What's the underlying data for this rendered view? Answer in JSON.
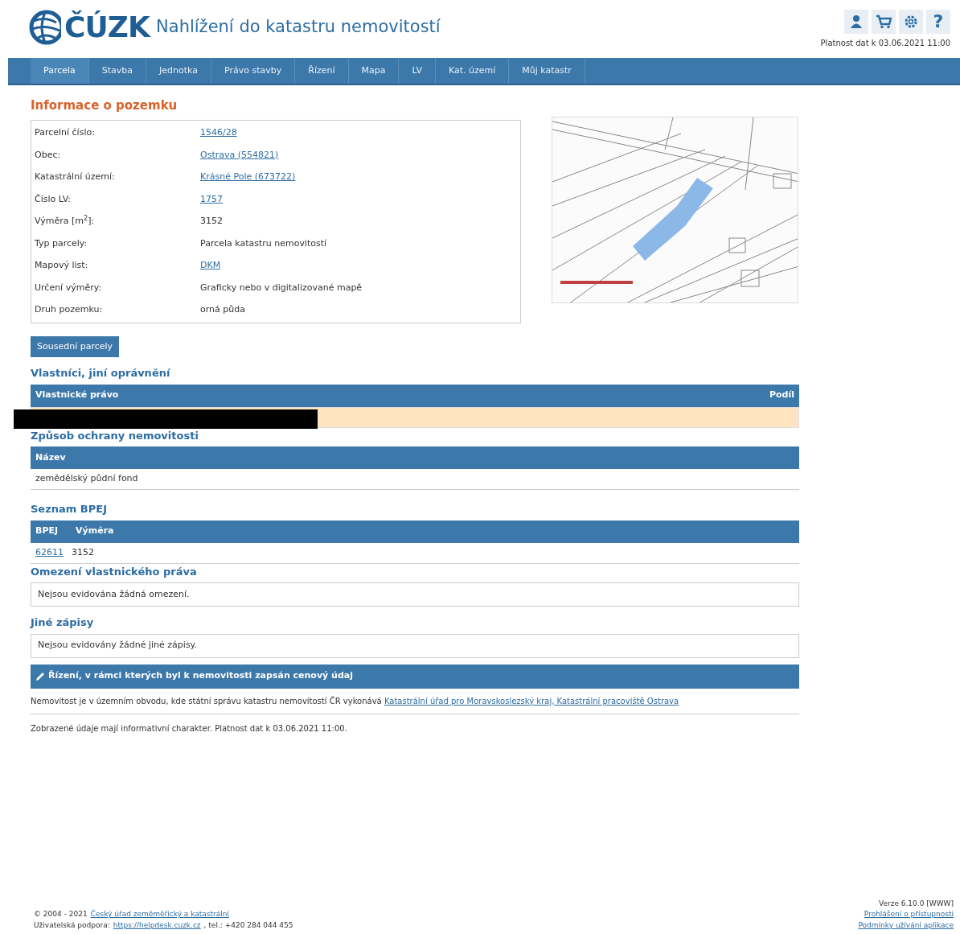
{
  "header": {
    "logo": "ČÚZK",
    "title": "Nahlížení do katastru nemovitostí",
    "validity": "Platnost dat k 03.06.2021 11:00",
    "help": "?"
  },
  "nav": [
    {
      "label": "Parcela",
      "selected": true
    },
    {
      "label": "Stavba",
      "selected": false
    },
    {
      "label": "Jednotka",
      "selected": false
    },
    {
      "label": "Právo stavby",
      "selected": false
    },
    {
      "label": "Řízení",
      "selected": false
    },
    {
      "label": "Mapa",
      "selected": false
    },
    {
      "label": "LV",
      "selected": false
    },
    {
      "label": "Kat. území",
      "selected": false
    },
    {
      "label": "Můj katastr",
      "selected": false
    }
  ],
  "info": {
    "title": "Informace o pozemku",
    "rows": [
      {
        "label": "Parcelní číslo:",
        "value": "1546/28",
        "link": true
      },
      {
        "label": "Obec:",
        "value": "Ostrava (554821)",
        "link": true
      },
      {
        "label": "Katastrální území:",
        "value": "Krásné Pole (673722)",
        "link": true
      },
      {
        "label": "Číslo LV:",
        "value": "1757",
        "link": true
      },
      {
        "label": "Výměra [m$^{2}$]:",
        "value": "3152",
        "link": false
      },
      {
        "label": "Typ parcely:",
        "value": "Parcela katastru nemovitostí",
        "link": false
      },
      {
        "label": "Mapový list:",
        "value": "DKM",
        "link": true
      },
      {
        "label": "Určení výměry:",
        "value": "Graficky nebo v digitalizované mapě",
        "link": false
      },
      {
        "label": "Druh pozemku:",
        "value": "orná půda",
        "link": false
      }
    ],
    "button": "Sousední parcely"
  },
  "owners": {
    "title": "Vlastníci, jiní oprávnění",
    "columns": [
      "Vlastnické právo",
      "Podíl"
    ],
    "redacted": true
  },
  "protection": {
    "title": "Způsob ochrany nemovitosti",
    "columns": [
      "Název"
    ],
    "rows": [
      "zemědělský půdní fond"
    ]
  },
  "bpej": {
    "title": "Seznam BPEJ",
    "columns": [
      "BPEJ",
      "Výměra"
    ],
    "rows": [
      {
        "code": "62611",
        "area": "3152"
      }
    ]
  },
  "restrictions": {
    "title": "Omezení vlastnického práva",
    "text": "Nejsou evidována žádná omezení."
  },
  "other": {
    "title": "Jiné zápisy",
    "text": "Nejsou evidovány žádné jiné zápisy."
  },
  "proceedings": {
    "title": "Řízení, v rámci kterých byl k nemovitosti zapsán cenový údaj",
    "text": "Nemovitost je v územním obvodu, kde státní správu katastru nemovitostí ČR vykonává",
    "link": "Katastrální úřad pro Moravskoslezský kraj, Katastrální pracoviště Ostrava"
  },
  "note": "Zobrazené údaje mají informativní charakter. Platnost dat k 03.06.2021 11:00.",
  "footer": {
    "copyright": "© 2004 - 2021",
    "org_link": "Český úřad zeměměřický a katastrální",
    "support_label": "Uživatelská podpora:",
    "support_link": "https://helpdesk.cuzk.cz",
    "phone": ", tel.: +420 284 044 455",
    "version": "Verze 6.10.0 [WWW]",
    "links": [
      "Prohlášení o přístupnosti",
      "Podmínky užívání aplikace"
    ]
  }
}
